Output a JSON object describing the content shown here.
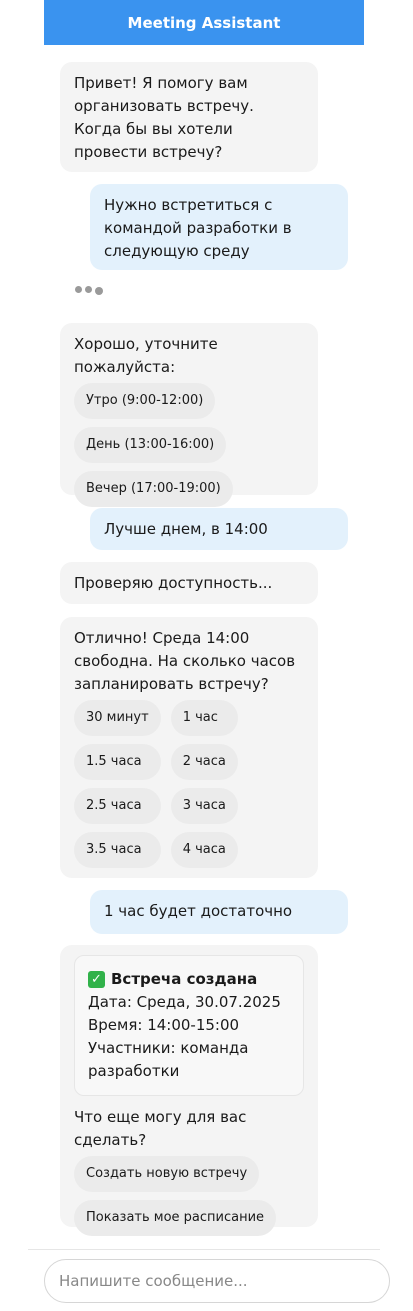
{
  "header": {
    "title": "Meeting Assistant"
  },
  "messages": {
    "m1": "Привет! Я помогу вам организовать встречу. Когда бы вы хотели провести встречу?",
    "m2": "Нужно встретиться с командой разработки в следующую среду",
    "m3": "Хорошо, уточните пожалуйста:",
    "m3_options": [
      "Утро (9:00-12:00)",
      "День (13:00-16:00)",
      "Вечер (17:00-19:00)"
    ],
    "m4": "Лучше днем, в 14:00",
    "m5": "Проверяю доступность...",
    "m6": "Отлично! Среда 14:00 свободна. На сколько часов запланировать встречу?",
    "m6_options": [
      "30 минут",
      "1 час",
      "1.5 часа",
      "2 часа",
      "2.5 часа",
      "3 часа",
      "3.5 часа",
      "4 часа"
    ],
    "m7": "1 час будет достаточно",
    "m8": {
      "card_title": "Встреча создана",
      "date": "Дата: Среда, 30.07.2025",
      "time": "Время: 14:00-15:00",
      "participants": "Участники: команда разработки",
      "followup": "Что еще могу для вас сделать?",
      "options": [
        "Создать новую встречу",
        "Показать мое расписание"
      ]
    }
  },
  "composer": {
    "placeholder": "Напишите сообщение..."
  },
  "icons": {
    "check": "check-icon",
    "typing": "typing-indicator"
  }
}
